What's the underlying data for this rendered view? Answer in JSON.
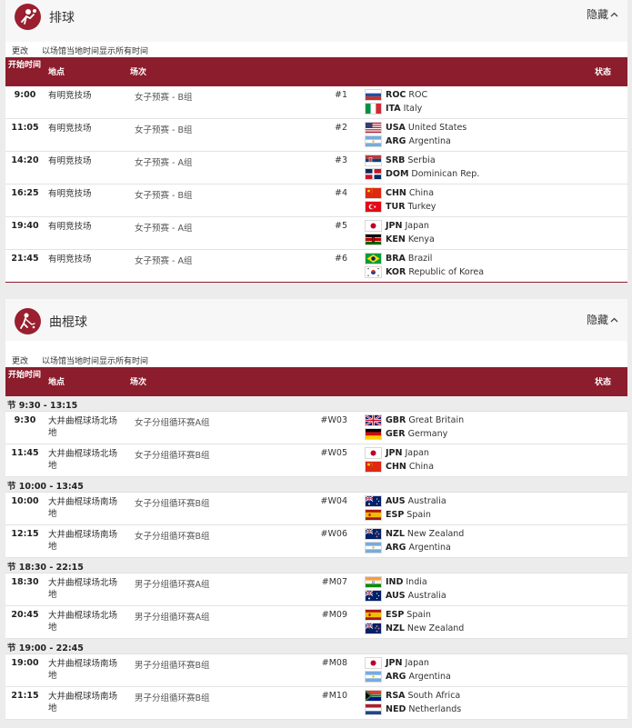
{
  "volleyball": {
    "title": "排球",
    "hide_label": "隐藏",
    "change_label": "更改",
    "local_time_label": "以场馆当地时间显示所有时间",
    "headers": {
      "time": "开始时间",
      "venue": "地点",
      "event": "场次",
      "status": "状态"
    },
    "rows": [
      {
        "time": "9:00",
        "venue": "有明竞技场",
        "event": "女子预赛 - B组",
        "num": "#1",
        "team1": {
          "code": "ROC",
          "name": "ROC",
          "flag": "roc"
        },
        "team2": {
          "code": "ITA",
          "name": "Italy",
          "flag": "ita"
        }
      },
      {
        "time": "11:05",
        "venue": "有明竞技场",
        "event": "女子预赛 - B组",
        "num": "#2",
        "team1": {
          "code": "USA",
          "name": "United States",
          "flag": "usa"
        },
        "team2": {
          "code": "ARG",
          "name": "Argentina",
          "flag": "arg"
        }
      },
      {
        "time": "14:20",
        "venue": "有明竞技场",
        "event": "女子预赛 - A组",
        "num": "#3",
        "team1": {
          "code": "SRB",
          "name": "Serbia",
          "flag": "srb"
        },
        "team2": {
          "code": "DOM",
          "name": "Dominican Rep.",
          "flag": "dom"
        }
      },
      {
        "time": "16:25",
        "venue": "有明竞技场",
        "event": "女子预赛 - B组",
        "num": "#4",
        "team1": {
          "code": "CHN",
          "name": "China",
          "flag": "chn"
        },
        "team2": {
          "code": "TUR",
          "name": "Turkey",
          "flag": "tur"
        }
      },
      {
        "time": "19:40",
        "venue": "有明竞技场",
        "event": "女子预赛 - A组",
        "num": "#5",
        "team1": {
          "code": "JPN",
          "name": "Japan",
          "flag": "jpn"
        },
        "team2": {
          "code": "KEN",
          "name": "Kenya",
          "flag": "ken"
        }
      },
      {
        "time": "21:45",
        "venue": "有明竞技场",
        "event": "女子预赛 - A组",
        "num": "#6",
        "team1": {
          "code": "BRA",
          "name": "Brazil",
          "flag": "bra"
        },
        "team2": {
          "code": "KOR",
          "name": "Republic of Korea",
          "flag": "kor"
        }
      }
    ]
  },
  "hockey": {
    "title": "曲棍球",
    "hide_label": "隐藏",
    "change_label": "更改",
    "local_time_label": "以场馆当地时间显示所有时间",
    "headers": {
      "time": "开始时间",
      "venue": "地点",
      "event": "场次",
      "status": "状态"
    },
    "sessions": [
      {
        "label": "节 9:30 - 13:15",
        "rows": [
          {
            "time": "9:30",
            "venue": "大井曲棍球场北场地",
            "event": "女子分组循环赛A组",
            "num": "#W03",
            "team1": {
              "code": "GBR",
              "name": "Great Britain",
              "flag": "gbr"
            },
            "team2": {
              "code": "GER",
              "name": "Germany",
              "flag": "ger"
            }
          },
          {
            "time": "11:45",
            "venue": "大井曲棍球场北场地",
            "event": "女子分组循环赛B组",
            "num": "#W05",
            "team1": {
              "code": "JPN",
              "name": "Japan",
              "flag": "jpn"
            },
            "team2": {
              "code": "CHN",
              "name": "China",
              "flag": "chn"
            }
          }
        ]
      },
      {
        "label": "节 10:00 - 13:45",
        "rows": [
          {
            "time": "10:00",
            "venue": "大井曲棍球场南场地",
            "event": "女子分组循环赛B组",
            "num": "#W04",
            "team1": {
              "code": "AUS",
              "name": "Australia",
              "flag": "aus"
            },
            "team2": {
              "code": "ESP",
              "name": "Spain",
              "flag": "esp"
            }
          },
          {
            "time": "12:15",
            "venue": "大井曲棍球场南场地",
            "event": "女子分组循环赛B组",
            "num": "#W06",
            "team1": {
              "code": "NZL",
              "name": "New Zealand",
              "flag": "nzl"
            },
            "team2": {
              "code": "ARG",
              "name": "Argentina",
              "flag": "arg"
            }
          }
        ]
      },
      {
        "label": "节 18:30 - 22:15",
        "rows": [
          {
            "time": "18:30",
            "venue": "大井曲棍球场北场地",
            "event": "男子分组循环赛A组",
            "num": "#M07",
            "team1": {
              "code": "IND",
              "name": "India",
              "flag": "ind"
            },
            "team2": {
              "code": "AUS",
              "name": "Australia",
              "flag": "aus"
            }
          },
          {
            "time": "20:45",
            "venue": "大井曲棍球场北场地",
            "event": "男子分组循环赛A组",
            "num": "#M09",
            "team1": {
              "code": "ESP",
              "name": "Spain",
              "flag": "esp"
            },
            "team2": {
              "code": "NZL",
              "name": "New Zealand",
              "flag": "nzl"
            }
          }
        ]
      },
      {
        "label": "节 19:00 - 22:45",
        "rows": [
          {
            "time": "19:00",
            "venue": "大井曲棍球场南场地",
            "event": "男子分组循环赛B组",
            "num": "#M08",
            "team1": {
              "code": "JPN",
              "name": "Japan",
              "flag": "jpn"
            },
            "team2": {
              "code": "ARG",
              "name": "Argentina",
              "flag": "arg"
            }
          },
          {
            "time": "21:15",
            "venue": "大井曲棍球场南场地",
            "event": "男子分组循环赛B组",
            "num": "#M10",
            "team1": {
              "code": "RSA",
              "name": "South Africa",
              "flag": "rsa"
            },
            "team2": {
              "code": "NED",
              "name": "Netherlands",
              "flag": "ned"
            }
          }
        ]
      }
    ]
  },
  "colors": {
    "header_bg": "#8b1d2c",
    "icon_bg": "#9a1f2f"
  }
}
